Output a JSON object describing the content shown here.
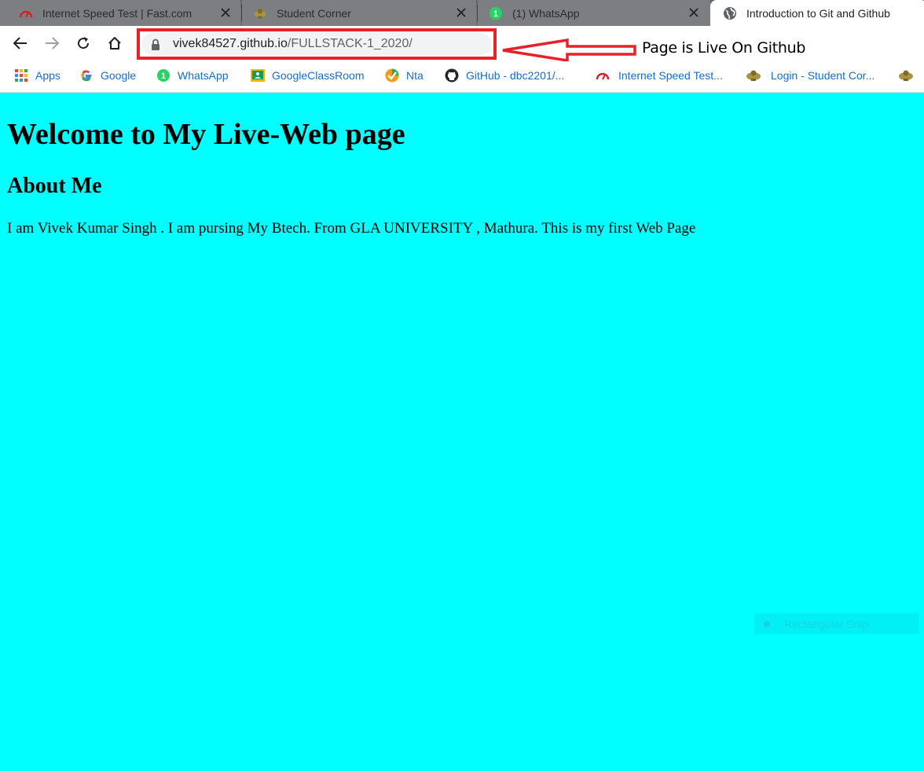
{
  "tabs": [
    {
      "title": "Internet Speed Test | Fast.com",
      "favicon": "speedometer-icon",
      "active": false
    },
    {
      "title": "Student Corner",
      "favicon": "emblem-icon",
      "active": false
    },
    {
      "title": "(1) WhatsApp",
      "favicon": "whatsapp-icon",
      "badge": "1",
      "active": false
    },
    {
      "title": "Introduction to Git and Github",
      "favicon": "globe-icon",
      "active": true
    }
  ],
  "toolbar": {
    "url_host": "vivek84527.github.io",
    "url_path": "/FULLSTACK-1_2020/",
    "annotation": "Page is Live On Github"
  },
  "bookmarks": [
    {
      "label": "Apps",
      "icon": "apps-grid-icon"
    },
    {
      "label": "Google",
      "icon": "google-icon"
    },
    {
      "label": "WhatsApp",
      "icon": "whatsapp-icon",
      "badge": "1"
    },
    {
      "label": "GoogleClassRoom",
      "icon": "classroom-icon"
    },
    {
      "label": "Nta",
      "icon": "nta-icon"
    },
    {
      "label": "GitHub - dbc2201/...",
      "icon": "github-icon"
    },
    {
      "label": "Internet Speed Test...",
      "icon": "speedometer-icon"
    },
    {
      "label": "Login - Student Cor...",
      "icon": "emblem-icon"
    }
  ],
  "page": {
    "heading": "Welcome to My Live-Web page",
    "subheading": "About Me",
    "paragraph": "I am Vivek Kumar Singh . I am pursing My Btech. From GLA UNIVERSITY , Mathura. This is my first Web Page",
    "background_color": "#00ffff"
  },
  "snip_overlay": {
    "label": "Rectangular Snip"
  },
  "colors": {
    "annotation_red": "#e8202a",
    "bookmark_text": "#1a6bc6"
  }
}
